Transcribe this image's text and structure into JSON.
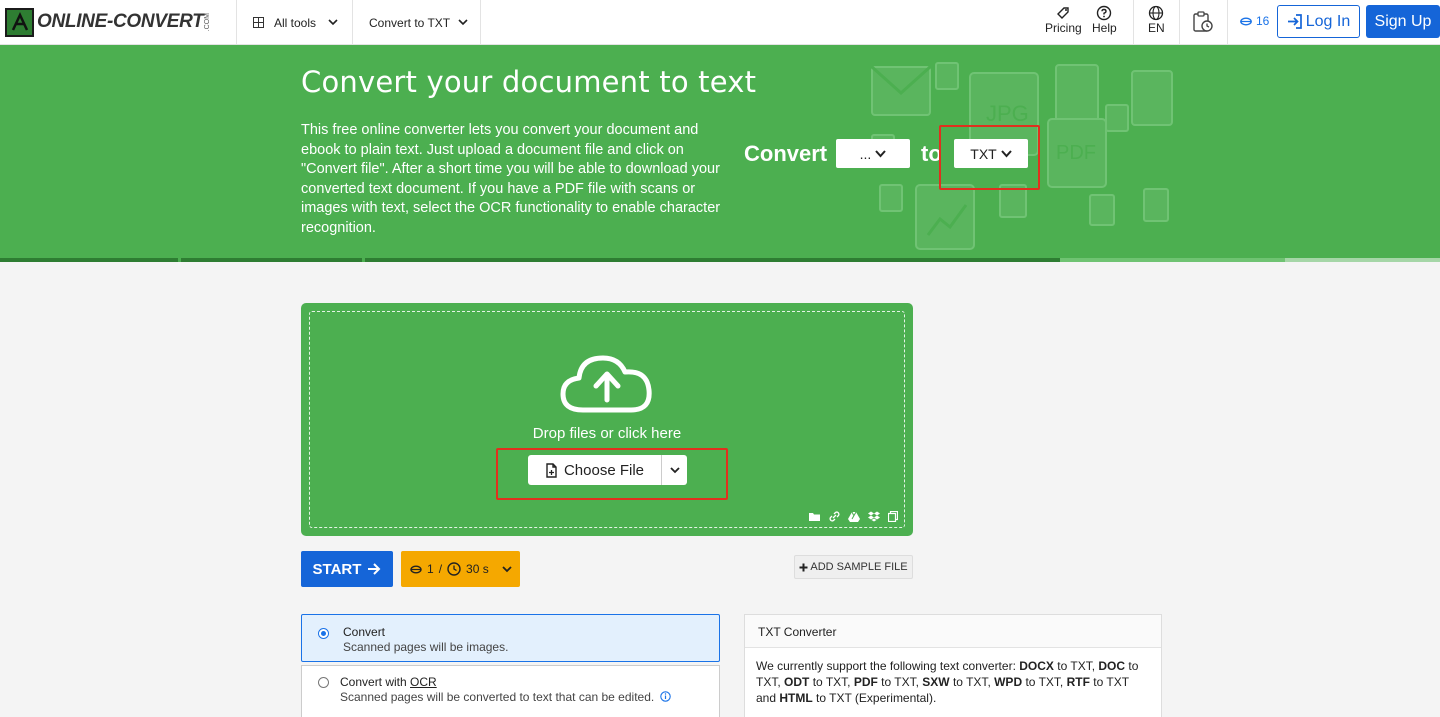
{
  "nav": {
    "logo_text": "ONLINE-CONVERT",
    "logo_suffix": ".COM",
    "all_tools": "All tools",
    "convert_to": "Convert to TXT",
    "pricing": "Pricing",
    "help": "Help",
    "language": "EN",
    "credits": "16",
    "login": "Log In",
    "signup": "Sign Up"
  },
  "hero": {
    "title": "Convert your document to text",
    "description": "This free online converter lets you convert your document and ebook to plain text. Just upload a document file and click on \"Convert file\". After a short time you will be able to download your converted text document. If you have a PDF file with scans or images with text, select the OCR functionality to enable character recognition.",
    "convert_label": "Convert",
    "from_value": "...",
    "to_label": "to",
    "to_value": "TXT",
    "bg_icon_labels": [
      "JPG",
      "PDF"
    ]
  },
  "upload": {
    "drop_text": "Drop files or click here",
    "choose_file": "Choose File"
  },
  "actions": {
    "start": "START",
    "cost_credits": "1",
    "cost_sep": "/",
    "cost_time": "30 s",
    "add_sample": "ADD SAMPLE FILE"
  },
  "options": [
    {
      "title": "Convert",
      "desc": "Scanned pages will be images."
    },
    {
      "title_prefix": "Convert with ",
      "title_ocr": "OCR",
      "desc": "Scanned pages will be converted to text that can be edited."
    }
  ],
  "info": {
    "title": "TXT Converter",
    "intro": "We currently support the following text converter: ",
    "formats": [
      "DOCX",
      "DOC",
      "ODT",
      "PDF",
      "SXW",
      "WPD",
      "RTF",
      "HTML"
    ],
    "to_txt": " to TXT",
    "sep": ", ",
    "and": " and ",
    "experimental": " to TXT (Experimental)."
  },
  "colors": {
    "brand_green": "#4caf50",
    "primary_blue": "#1565d8",
    "cost_orange": "#f5a800",
    "highlight_red": "#e0301e"
  }
}
